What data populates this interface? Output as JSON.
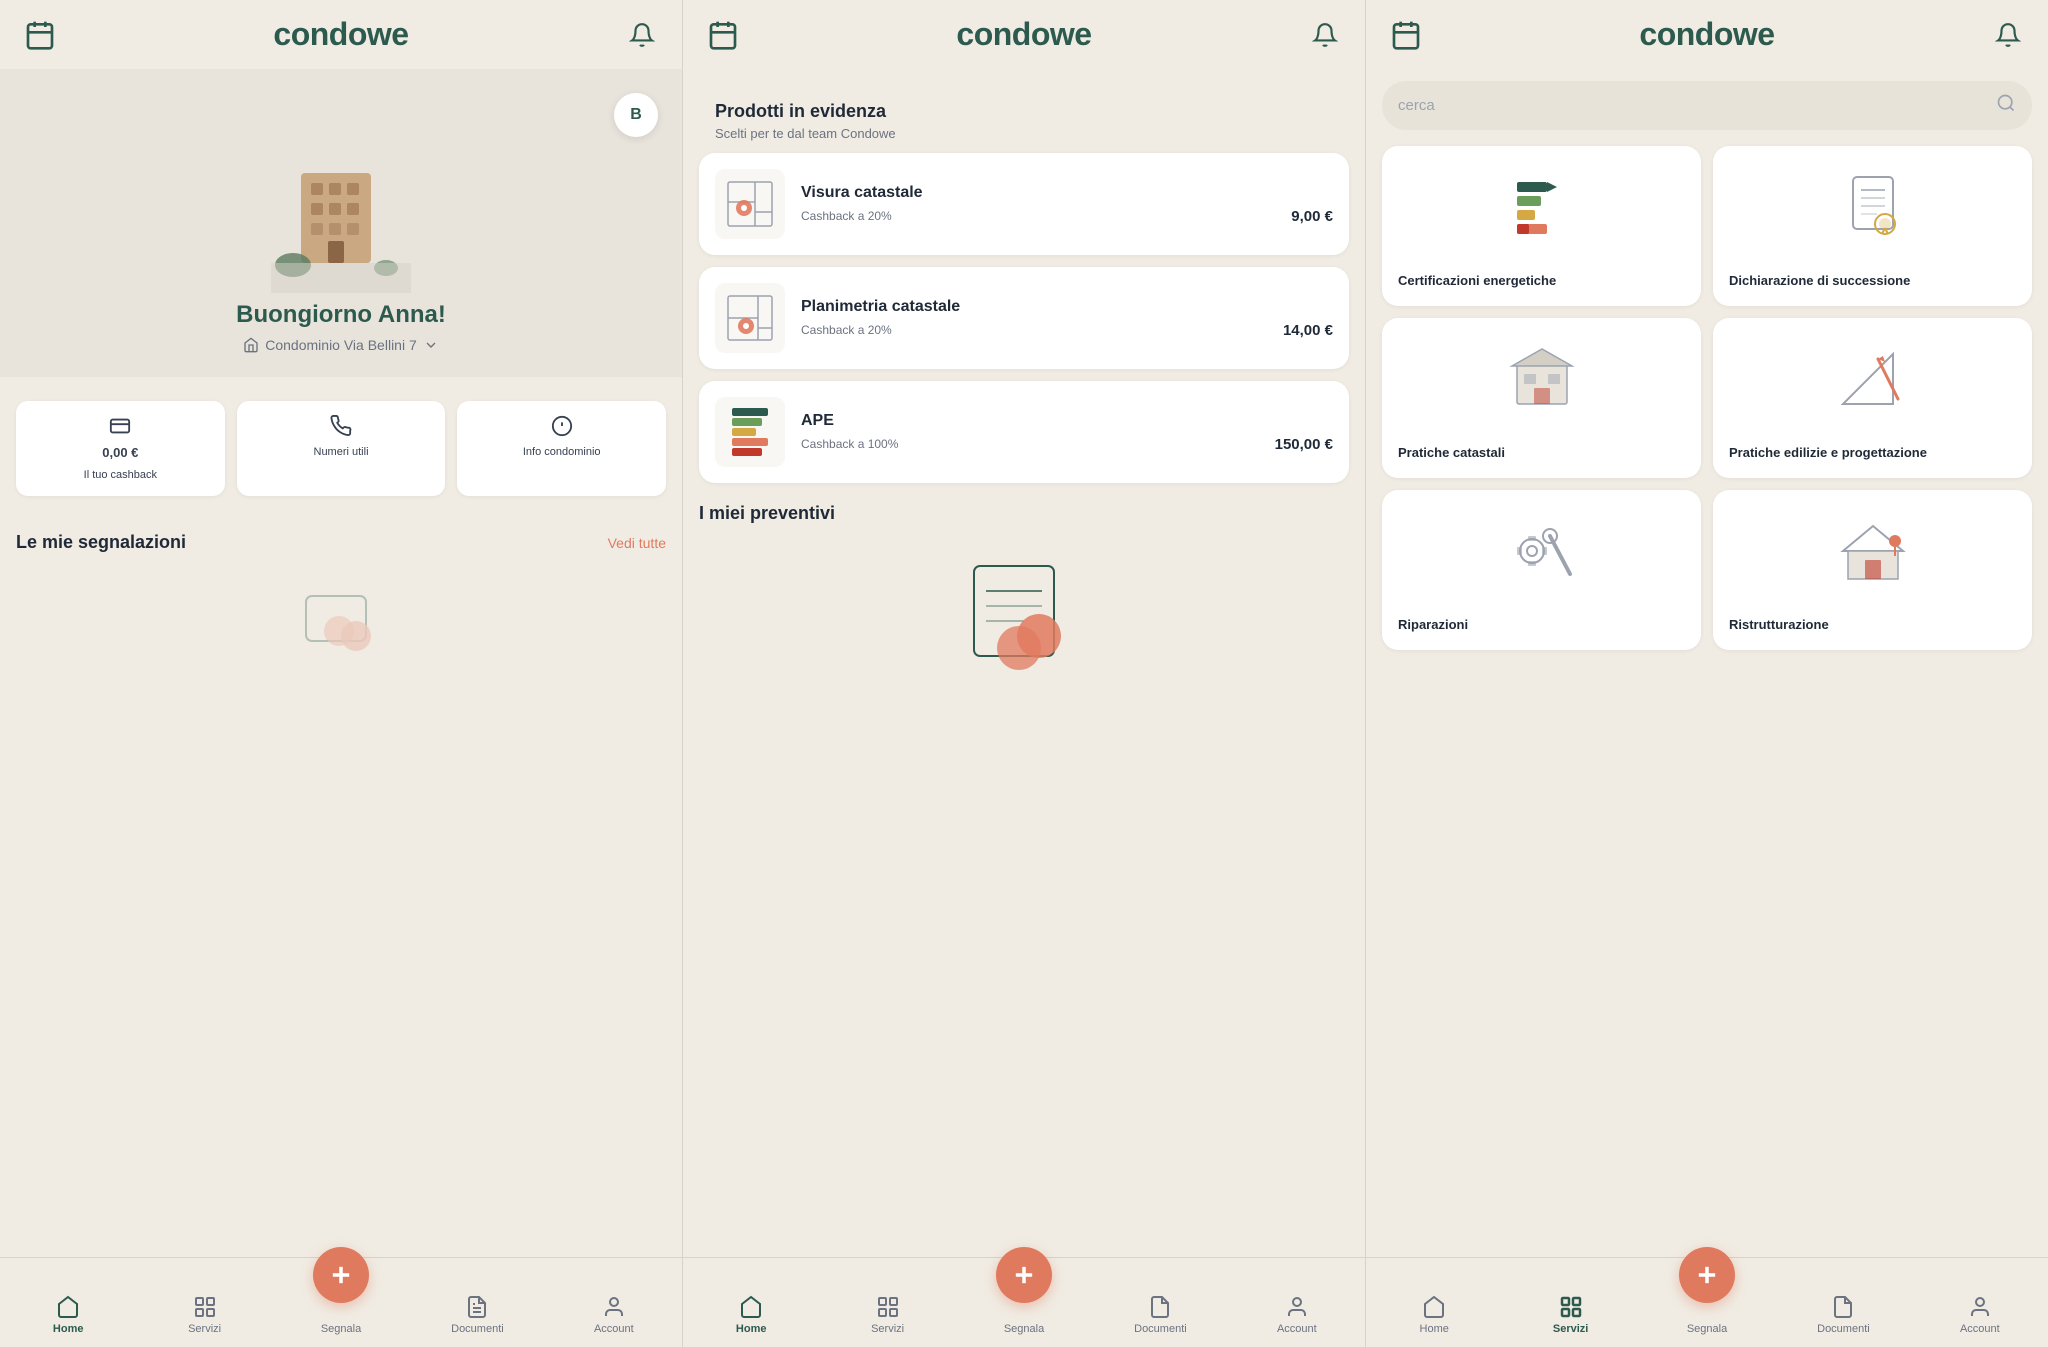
{
  "app": {
    "name": "condowe",
    "logo_color": "#2d5a4e"
  },
  "screen1": {
    "title": "Home",
    "user": {
      "greeting": "Buongiorno Anna!",
      "avatar_initial": "B",
      "condo_name": "Condominio Via Bellini 7"
    },
    "quick_actions": [
      {
        "id": "cashback",
        "amount": "0,00 €",
        "label": "Il tuo cashback"
      },
      {
        "id": "numeri",
        "label": "Numeri utili"
      },
      {
        "id": "info",
        "label": "Info condominio"
      }
    ],
    "segnalazioni": {
      "title": "Le mie segnalazioni",
      "cta": "Vedi tutte"
    },
    "nav": {
      "items": [
        {
          "id": "home",
          "label": "Home",
          "active": true
        },
        {
          "id": "servizi",
          "label": "Servizi",
          "active": false
        },
        {
          "id": "segnala",
          "label": "Segnala",
          "active": false
        },
        {
          "id": "documenti",
          "label": "Documenti",
          "active": false
        },
        {
          "id": "account",
          "label": "Account",
          "active": false
        }
      ]
    }
  },
  "screen2": {
    "title": "Home",
    "prodotti": {
      "title": "Prodotti in evidenza",
      "subtitle": "Scelti per te dal team Condowe",
      "items": [
        {
          "id": "visura",
          "name": "Visura catastale",
          "cashback": "Cashback a 20%",
          "price": "9,00 €"
        },
        {
          "id": "planimetria",
          "name": "Planimetria catastale",
          "cashback": "Cashback a 20%",
          "price": "14,00 €"
        },
        {
          "id": "ape",
          "name": "APE",
          "cashback": "Cashback a 100%",
          "price": "150,00 €"
        }
      ]
    },
    "preventivi": {
      "title": "I miei preventivi"
    },
    "nav": {
      "items": [
        {
          "id": "home",
          "label": "Home",
          "active": true
        },
        {
          "id": "servizi",
          "label": "Servizi",
          "active": false
        },
        {
          "id": "segnala",
          "label": "Segnala",
          "active": false
        },
        {
          "id": "documenti",
          "label": "Documenti",
          "active": false
        },
        {
          "id": "account",
          "label": "Account",
          "active": false
        }
      ]
    }
  },
  "screen3": {
    "title": "Servizi",
    "search": {
      "placeholder": "cerca"
    },
    "services": [
      {
        "id": "certificazioni",
        "name": "Certificazioni energetiche"
      },
      {
        "id": "dichiarazione",
        "name": "Dichiarazione di successione"
      },
      {
        "id": "pratiche-catastali",
        "name": "Pratiche catastali"
      },
      {
        "id": "pratiche-edilizie",
        "name": "Pratiche edilizie e progettazione"
      },
      {
        "id": "riparazioni",
        "name": "Riparazioni"
      },
      {
        "id": "ristrutturazione",
        "name": "Ristrutturazione"
      }
    ],
    "nav": {
      "items": [
        {
          "id": "home",
          "label": "Home",
          "active": false
        },
        {
          "id": "servizi",
          "label": "Servizi",
          "active": true
        },
        {
          "id": "segnala",
          "label": "Segnala",
          "active": false
        },
        {
          "id": "documenti",
          "label": "Documenti",
          "active": false
        },
        {
          "id": "account",
          "label": "Account",
          "active": false
        }
      ]
    }
  }
}
